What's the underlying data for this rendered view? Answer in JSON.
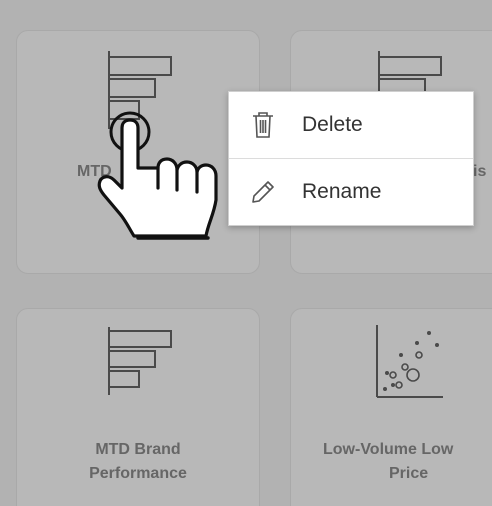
{
  "cards": [
    {
      "label_line1": "MTD",
      "label_line2": "",
      "icon": "bar-chart-icon"
    },
    {
      "label_line1": "is",
      "label_line2": "",
      "icon": "bar-chart-icon"
    },
    {
      "label_line1": "MTD Brand",
      "label_line2": "Performance",
      "icon": "bar-chart-icon"
    },
    {
      "label_line1": "Low-Volume Low",
      "label_line2": "Price",
      "icon": "scatter-chart-icon"
    }
  ],
  "context_menu": {
    "items": [
      {
        "label": "Delete",
        "icon": "trash-icon"
      },
      {
        "label": "Rename",
        "icon": "pencil-icon"
      }
    ]
  },
  "cursor": {
    "icon": "hand-pointer-icon"
  },
  "colors": {
    "background": "#b2b2b2",
    "card": "#b8b8b8",
    "card_text": "#666666",
    "icon_stroke": "#4a4a4a",
    "menu_bg": "#ffffff"
  }
}
